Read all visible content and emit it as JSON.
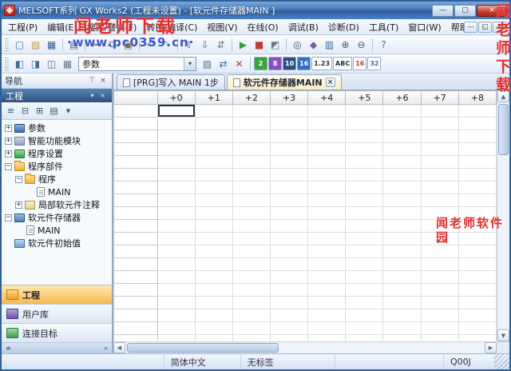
{
  "window": {
    "title": "MELSOFT系列 GX Works2 (工程未设置) - [软元件存储器MAIN ]",
    "controls": {
      "minimize": "—",
      "maximize": "▢",
      "close": "×"
    }
  },
  "menu": {
    "items": [
      "工程(P)",
      "编辑(E)",
      "搜索/替换(F)",
      "转换/编译(C)",
      "视图(V)",
      "在线(O)",
      "调试(B)",
      "诊断(D)",
      "工具(T)",
      "窗口(W)",
      "帮助(H)"
    ],
    "child_controls": [
      "—",
      "◱",
      "×"
    ]
  },
  "toolbar1": {
    "icons": [
      {
        "name": "new-project-icon",
        "glyph": "▢",
        "color": "#2f6fbf"
      },
      {
        "name": "open-project-icon",
        "glyph": "▨",
        "color": "#d09a2a"
      },
      {
        "name": "save-icon",
        "glyph": "▦",
        "color": "#2f5f9f"
      },
      {
        "name": "sep"
      },
      {
        "name": "print-icon",
        "glyph": "▤",
        "color": "#5a6a7a"
      },
      {
        "name": "sep"
      },
      {
        "name": "cut-icon",
        "glyph": "✂",
        "color": "#4a5a6a"
      },
      {
        "name": "copy-icon",
        "glyph": "⧉",
        "color": "#4a5a6a"
      },
      {
        "name": "paste-icon",
        "glyph": "▣",
        "color": "#8a6a3a"
      },
      {
        "name": "sep"
      },
      {
        "name": "undo-icon",
        "glyph": "↶",
        "color": "#2f6fbf"
      },
      {
        "name": "redo-icon",
        "glyph": "↷",
        "color": "#8a9ab0"
      },
      {
        "name": "sep"
      },
      {
        "name": "write-to-plc-icon",
        "glyph": "⇧",
        "color": "#2f8f3f"
      },
      {
        "name": "read-from-plc-icon",
        "glyph": "⇩",
        "color": "#2f6fbf"
      },
      {
        "name": "verify-icon",
        "glyph": "⇵",
        "color": "#6a7a8a"
      },
      {
        "name": "sep"
      },
      {
        "name": "monitor-start-icon",
        "glyph": "▶",
        "color": "#2f9f3f"
      },
      {
        "name": "monitor-stop-icon",
        "glyph": "■",
        "color": "#c43c30"
      },
      {
        "name": "device-test-icon",
        "glyph": "◩",
        "color": "#6a7a8a"
      },
      {
        "name": "sep"
      },
      {
        "name": "find-icon",
        "glyph": "◎",
        "color": "#3a5a7a"
      },
      {
        "name": "cross-reference-icon",
        "glyph": "◆",
        "color": "#7a5aa0"
      },
      {
        "name": "device-list-icon",
        "glyph": "▥",
        "color": "#3a6a9a"
      },
      {
        "name": "zoom-in-icon",
        "glyph": "⊕",
        "color": "#3a5a7a"
      },
      {
        "name": "zoom-out-icon",
        "glyph": "⊖",
        "color": "#3a5a7a"
      },
      {
        "name": "sep"
      },
      {
        "name": "help-icon",
        "glyph": "?",
        "color": "#2f6fbf"
      }
    ]
  },
  "toolbar2": {
    "left_icons": [
      {
        "name": "navigation-window-icon",
        "glyph": "◧",
        "color": "#3a6a9a"
      },
      {
        "name": "function-block-window-icon",
        "glyph": "◨",
        "color": "#3a6a9a"
      },
      {
        "name": "output-window-icon",
        "glyph": "◫",
        "color": "#5a6a7a"
      },
      {
        "name": "docking-layout-icon",
        "glyph": "▦",
        "color": "#6a7a8a"
      }
    ],
    "combo_value": "参数",
    "mid_icons": [
      {
        "name": "device-fill-icon",
        "glyph": "▨",
        "color": "#5a6a7a"
      },
      {
        "name": "device-transfer-icon",
        "glyph": "⇄",
        "color": "#2f6fbf"
      },
      {
        "name": "device-clear-icon",
        "glyph": "✕",
        "color": "#8a4a4a"
      },
      {
        "name": "sep"
      }
    ],
    "format_icons": [
      {
        "name": "binary-format-icon",
        "label": "2",
        "bg": "#3aa53a",
        "fg": "#ffffff"
      },
      {
        "name": "octal-format-icon",
        "label": "8",
        "bg": "#8a4fc7",
        "fg": "#ffffff"
      },
      {
        "name": "decimal-format-icon",
        "label": "10",
        "bg": "#2f4f7f",
        "fg": "#ffffff"
      },
      {
        "name": "hex-format-icon",
        "label": "16",
        "bg": "#2f6fbf",
        "fg": "#ffffff"
      },
      {
        "name": "real-format-icon",
        "label": "1.23",
        "bg": "#ffffff",
        "fg": "#223344"
      },
      {
        "name": "ascii-format-icon",
        "label": "ABC",
        "bg": "#ffffff",
        "fg": "#223344"
      },
      {
        "name": "word-16-icon",
        "label": "16",
        "bg": "#ffffff",
        "fg": "#c43c30"
      },
      {
        "name": "dword-32-icon",
        "label": "32",
        "bg": "#ffffff",
        "fg": "#2f6fbf"
      }
    ]
  },
  "sidebar": {
    "header_title": "导航",
    "section_title": "工程",
    "toolbar_icons": [
      {
        "name": "tree-view-icon",
        "glyph": "≡",
        "color": "#3a5a7a"
      },
      {
        "name": "collapse-all-icon",
        "glyph": "⊟",
        "color": "#3a5a7a"
      },
      {
        "name": "expand-all-icon",
        "glyph": "⊞",
        "color": "#3a5a7a"
      },
      {
        "name": "sort-icon",
        "glyph": "▤",
        "color": "#3a5a7a"
      },
      {
        "name": "filter-dropdown-icon",
        "glyph": "▾",
        "color": "#3a5a7a"
      }
    ],
    "tree": [
      {
        "label": "参数",
        "level": 0,
        "expand": "+",
        "icon": "param"
      },
      {
        "label": "智能功能模块",
        "level": 0,
        "expand": "+",
        "icon": "module"
      },
      {
        "label": "程序设置",
        "level": 0,
        "expand": "+",
        "icon": "setting"
      },
      {
        "label": "程序部件",
        "level": 0,
        "expand": "-",
        "icon": "folder"
      },
      {
        "label": "程序",
        "level": 1,
        "expand": "-",
        "icon": "folder"
      },
      {
        "label": "MAIN",
        "level": 2,
        "expand": "",
        "icon": "page"
      },
      {
        "label": "局部软元件注释",
        "level": 1,
        "expand": "+",
        "icon": "comment"
      },
      {
        "label": "软元件存储器",
        "level": 0,
        "expand": "-",
        "icon": "devmem"
      },
      {
        "label": "MAIN",
        "level": 1,
        "expand": "",
        "icon": "page"
      },
      {
        "label": "软元件初始值",
        "level": 0,
        "expand": "",
        "icon": "devinit"
      }
    ],
    "bottom_buttons": [
      {
        "label": "工程",
        "icon": "project",
        "active": true
      },
      {
        "label": "用户库",
        "icon": "userlib",
        "active": false
      },
      {
        "label": "连接目标",
        "icon": "connection",
        "active": false
      }
    ]
  },
  "tabs": [
    {
      "label": "[PRG]写入 MAIN 1步",
      "active": false,
      "closable": false
    },
    {
      "label": "软元件存储器MAIN",
      "active": true,
      "closable": true
    }
  ],
  "grid": {
    "corner_label": "",
    "columns": [
      "+0",
      "+1",
      "+2",
      "+3",
      "+4",
      "+5",
      "+6",
      "+7",
      "+8"
    ],
    "rows": 19,
    "selected_cell": {
      "row": 0,
      "col": 0
    }
  },
  "statusbar": {
    "items": [
      "",
      "简体中文",
      "无标签",
      "",
      "Q00J",
      ""
    ]
  },
  "icons": {
    "chevron_down": "▾",
    "pin": "⊤",
    "close": "×",
    "scroll_up": "▲",
    "scroll_down": "▼",
    "scroll_left": "◀",
    "scroll_right": "▶",
    "chevrons": "»",
    "menu_grip": "≡"
  },
  "watermarks": {
    "top_text": "闻老师下载",
    "url": "·www.pc0359.cn·",
    "side_text": "闻老师下载",
    "right_text": "闻老师软件园"
  }
}
